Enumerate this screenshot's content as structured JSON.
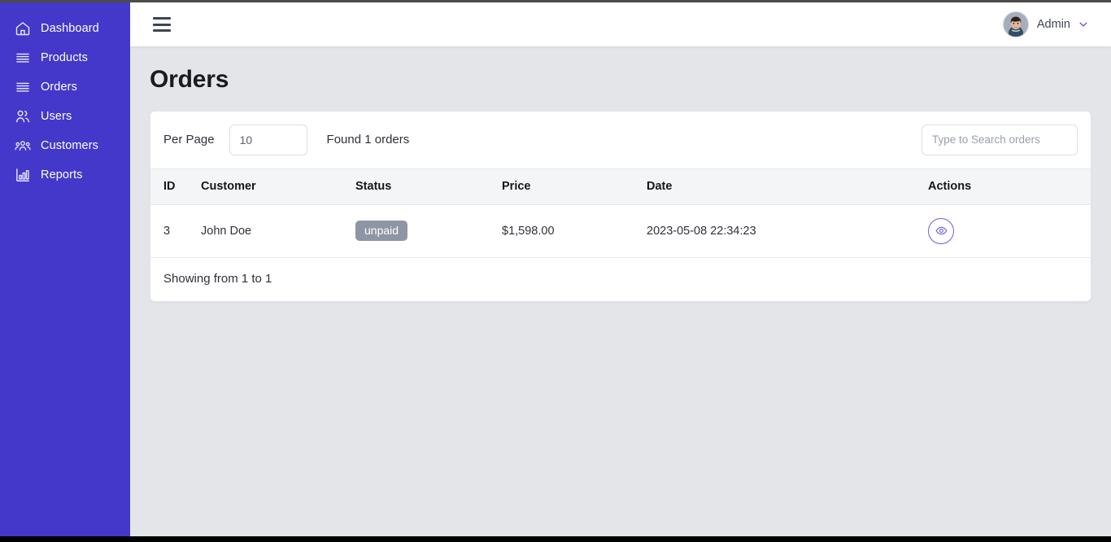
{
  "sidebar": {
    "items": [
      {
        "label": "Dashboard",
        "icon": "home-icon",
        "name": "sidebar-item-dashboard"
      },
      {
        "label": "Products",
        "icon": "list-icon",
        "name": "sidebar-item-products"
      },
      {
        "label": "Orders",
        "icon": "list-icon",
        "name": "sidebar-item-orders"
      },
      {
        "label": "Users",
        "icon": "users-icon",
        "name": "sidebar-item-users"
      },
      {
        "label": "Customers",
        "icon": "customers-icon",
        "name": "sidebar-item-customers"
      },
      {
        "label": "Reports",
        "icon": "bar-chart-icon",
        "name": "sidebar-item-reports"
      }
    ]
  },
  "header": {
    "menu_icon": "hamburger-icon",
    "user_name": "Admin",
    "avatar_icon": "avatar-photo",
    "chevron_icon": "chevron-down-icon"
  },
  "main": {
    "page_title": "Orders",
    "toolbar": {
      "per_page_label": "Per Page",
      "per_page_value": "10",
      "found_text": "Found 1 orders",
      "search_placeholder": "Type to Search orders",
      "search_value": ""
    },
    "table": {
      "columns": [
        "ID",
        "Customer",
        "Status",
        "Price",
        "Date",
        "Actions"
      ],
      "rows": [
        {
          "id": "3",
          "customer": "John Doe",
          "status": "unpaid",
          "price": "$1,598.00",
          "date": "2023-05-08 22:34:23",
          "action_icon": "eye-icon"
        }
      ]
    },
    "footer_text": "Showing from 1 to 1"
  },
  "colors": {
    "sidebar_bg": "#4338ca",
    "accent": "#6d5fe0",
    "page_bg": "#e4e5e9",
    "badge_unpaid": "#8e95a4",
    "header_bg": "#ffffff",
    "table_head_bg": "#f4f5f7"
  }
}
